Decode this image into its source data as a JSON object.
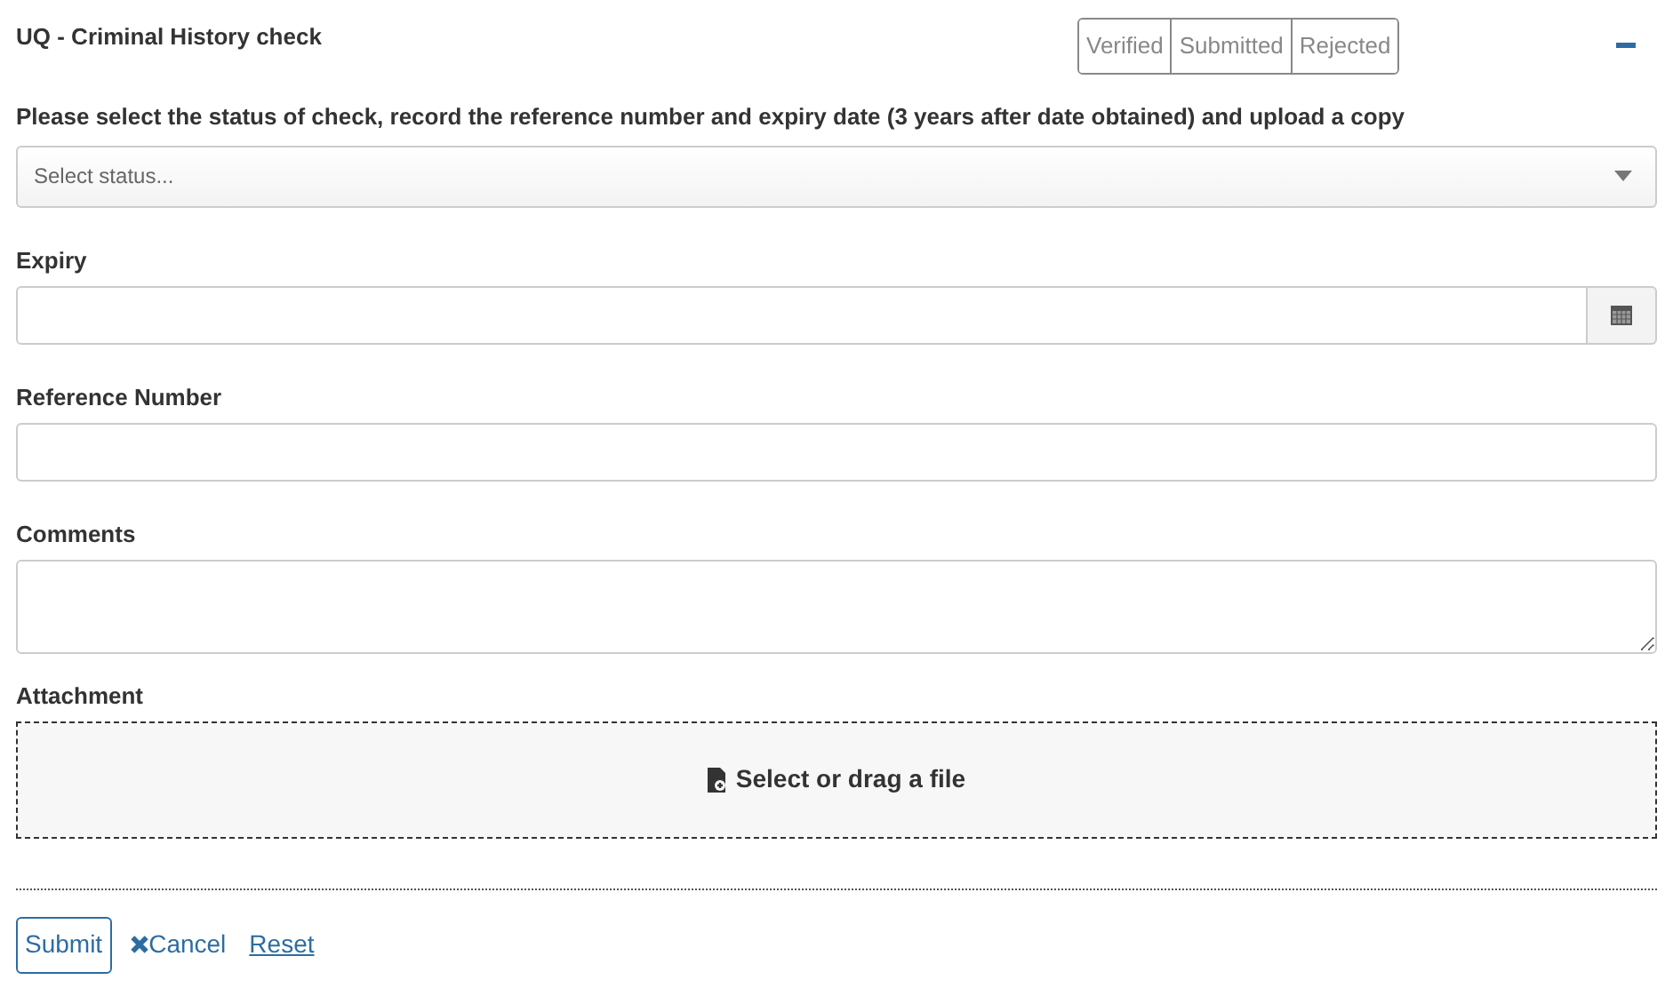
{
  "title": "UQ - Criminal History check",
  "status_buttons": [
    {
      "label": "Verified",
      "selected": false
    },
    {
      "label": "Submitted",
      "selected": false
    },
    {
      "label": "Rejected",
      "selected": false
    }
  ],
  "collapse": {
    "expanded": true
  },
  "instruction": "Please select the status of check, record the reference number and expiry date (3 years after date obtained) and upload a copy",
  "status_select": {
    "placeholder": "Select status..."
  },
  "fields": [
    {
      "kind": "date",
      "label": "Expiry"
    },
    {
      "kind": "text",
      "label": "Reference Number"
    },
    {
      "kind": "textarea",
      "label": "Comments"
    },
    {
      "kind": "file",
      "label": "Attachment",
      "prompt": "Select or drag a file"
    }
  ],
  "actions": {
    "submit": "Submit",
    "cancel": "Cancel",
    "reset": "Reset"
  }
}
